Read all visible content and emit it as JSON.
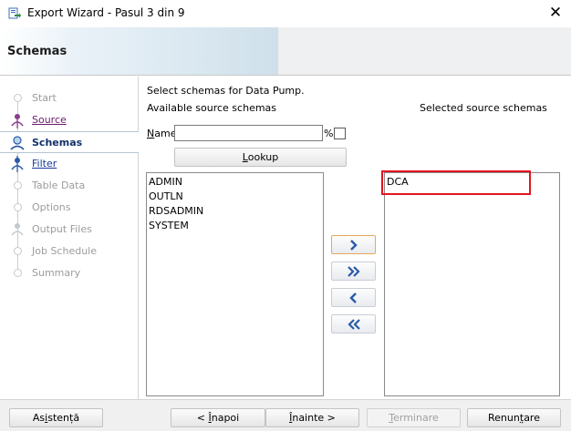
{
  "window": {
    "title": "Export Wizard - Pasul 3 din 9",
    "icon": "export-wizard-icon",
    "close_icon": "close-icon"
  },
  "banner": {
    "heading": "Schemas"
  },
  "steps": [
    {
      "label": "Start",
      "state": "disabled"
    },
    {
      "label": "Source",
      "state": "visited"
    },
    {
      "label": "Schemas",
      "state": "active"
    },
    {
      "label": "Filter",
      "state": "link"
    },
    {
      "label": "Table Data",
      "state": "disabled"
    },
    {
      "label": "Options",
      "state": "disabled"
    },
    {
      "label": "Output Files",
      "state": "disabled"
    },
    {
      "label": "Job Schedule",
      "state": "disabled"
    },
    {
      "label": "Summary",
      "state": "disabled"
    }
  ],
  "content": {
    "instruction": "Select schemas for Data Pump.",
    "available_label": "Available source schemas",
    "selected_label": "Selected source schemas",
    "name_label": "Name",
    "name_mnemonic": "N",
    "name_rest": "ame",
    "name_value": "",
    "percent_label": "%",
    "percent_checked": false,
    "lookup_label": "Lookup",
    "lookup_mnemonic": "L",
    "lookup_rest": "ookup",
    "available_schemas": [
      "ADMIN",
      "OUTLN",
      "RDSADMIN",
      "SYSTEM"
    ],
    "selected_schemas": [
      "DCA"
    ]
  },
  "move_buttons": [
    {
      "name": "move-right-button",
      "icon": "chevron-right-icon"
    },
    {
      "name": "move-all-right-button",
      "icon": "double-chevron-right-icon"
    },
    {
      "name": "move-left-button",
      "icon": "chevron-left-icon"
    },
    {
      "name": "move-all-left-button",
      "icon": "double-chevron-left-icon"
    }
  ],
  "footer": {
    "help_pre": "As",
    "help_mn": "i",
    "help_post": "stență",
    "back_pre": "< ",
    "back_mn": "Î",
    "back_post": "napoi",
    "next_mn": "Î",
    "next_post": "nainte >",
    "finish_mn": "T",
    "finish_post": "erminare",
    "cancel_pre": "Renun",
    "cancel_mn": "ț",
    "cancel_post": "are"
  },
  "colors": {
    "highlight": "#e2151e",
    "active_step": "#12306a",
    "visited_step": "#6a1b6a",
    "link_step": "#16389c"
  }
}
